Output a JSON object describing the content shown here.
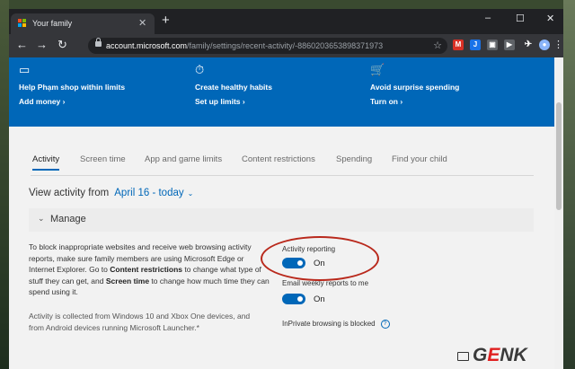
{
  "browser": {
    "tab_title": "Your family",
    "tab_close": "✕",
    "new_tab": "+",
    "window_controls": [
      "–",
      "☐",
      "✕"
    ],
    "nav": {
      "back": "←",
      "forward": "→",
      "reload": "↻"
    },
    "url_host": "account.microsoft.com",
    "url_path": "/family/settings/recent-activity/-8860203653898371973",
    "star": "☆",
    "extensions": [
      {
        "name": "gmail-icon",
        "label": "M",
        "color": "#d93025"
      },
      {
        "name": "j-extension-icon",
        "label": "J",
        "color": "#1a73e8"
      },
      {
        "name": "image-extension-icon",
        "label": "▣",
        "color": "#5f6368"
      },
      {
        "name": "video-extension-icon",
        "label": "▶",
        "color": "#5f6368"
      },
      {
        "name": "airplane-icon",
        "label": "✈",
        "color": "#35363a"
      },
      {
        "name": "profile-avatar-icon",
        "label": "●",
        "color": "#8ab4f8"
      }
    ],
    "menu": "⋮"
  },
  "banner": {
    "color": "#0067b8",
    "items": [
      {
        "icon": "▭",
        "title": "Help Phạm shop within limits",
        "link": "Add money ›"
      },
      {
        "icon": "⏱",
        "title": "Create healthy habits",
        "link": "Set up limits ›"
      },
      {
        "icon": "🛒",
        "title": "Avoid surprise spending",
        "link": "Turn on ›"
      }
    ]
  },
  "tabs": [
    "Activity",
    "Screen time",
    "App and game limits",
    "Content restrictions",
    "Spending",
    "Find your child"
  ],
  "active_tab": "Activity",
  "view": {
    "label": "View activity from",
    "range": "April 16 - today",
    "chevron": "⌄"
  },
  "manage": {
    "chevron": "⌄",
    "label": "Manage"
  },
  "description": {
    "part1": "To block inappropriate websites and receive web browsing activity reports, make sure family members are using Microsoft Edge or Internet Explorer. Go to ",
    "bold1": "Content restrictions",
    "part2": " to change what type of stuff they can get, and ",
    "bold2": "Screen time",
    "part3": " to change how much time they can spend using it."
  },
  "note": "Activity is collected from Windows 10 and Xbox One devices, and from Android devices running Microsoft Launcher.*",
  "settings": {
    "activity_reporting": {
      "label": "Activity reporting",
      "state": "On"
    },
    "email_reports": {
      "label": "Email weekly reports to me",
      "state": "On"
    },
    "inprivate": {
      "label": "InPrivate browsing is blocked",
      "info": "?"
    }
  },
  "accent_color": "#0067b8",
  "annotation_color": "#b9291c",
  "watermark": {
    "prefix": "G",
    "highlight": "E",
    "suffix": "NK"
  }
}
